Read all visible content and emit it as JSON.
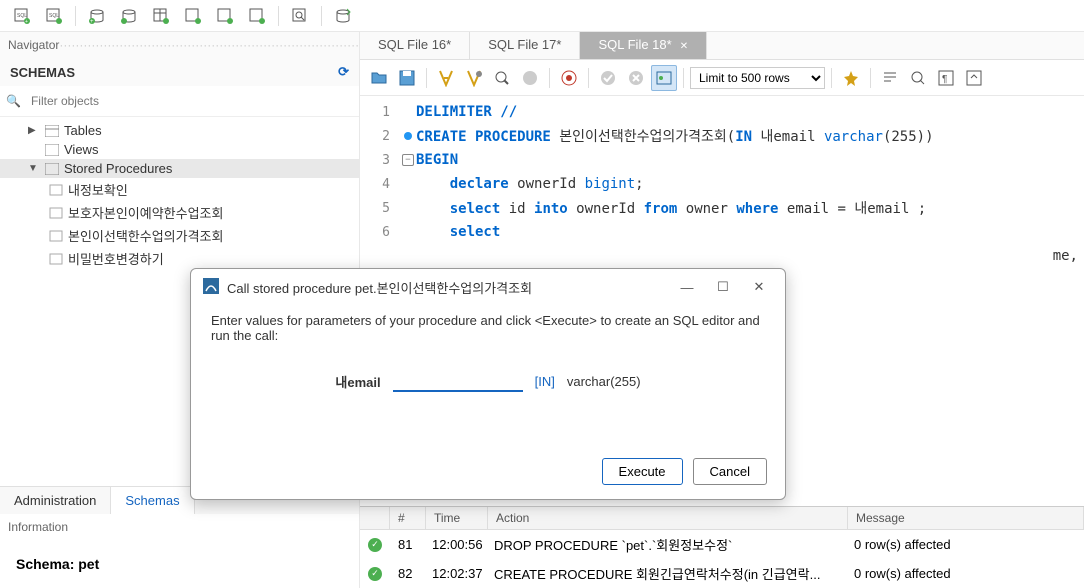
{
  "navigator": {
    "title": "Navigator"
  },
  "schemas": {
    "header": "SCHEMAS",
    "filter_placeholder": "Filter objects",
    "tree": {
      "tables": "Tables",
      "views": "Views",
      "stored_procs": "Stored Procedures",
      "sp_items": [
        "내정보확인",
        "보호자본인이예약한수업조회",
        "본인이선택한수업의가격조회",
        "비밀번호변경하기"
      ]
    }
  },
  "lower_tabs": {
    "admin": "Administration",
    "schemas": "Schemas"
  },
  "info": {
    "header": "Information",
    "schema_label": "Schema: ",
    "schema_value": "pet"
  },
  "file_tabs": [
    {
      "label": "SQL File 16*"
    },
    {
      "label": "SQL File 17*"
    },
    {
      "label": "SQL File 18*",
      "active": true
    }
  ],
  "editor_tb": {
    "limit": "Limit to 500 rows"
  },
  "code": {
    "l1": "DELIMITER //",
    "l2_a": "CREATE PROCEDURE ",
    "l2_b": "본인이선택한수업의가격조회",
    "l2_c": "(",
    "l2_d": "IN",
    "l2_e": " 내email ",
    "l2_f": "varchar",
    "l2_g": "(255))",
    "l3": "BEGIN",
    "l4_a": "    declare ",
    "l4_b": "ownerId ",
    "l4_c": "bigint",
    "l4_d": ";",
    "l5_a": "    select ",
    "l5_b": "id ",
    "l5_c": "into ",
    "l5_d": "ownerId ",
    "l5_e": "from ",
    "l5_f": "owner ",
    "l5_g": "where ",
    "l5_h": "email = 내email ;",
    "l6": "    select",
    "trail": "me,"
  },
  "output": {
    "cols": {
      "num": "#",
      "time": "Time",
      "action": "Action",
      "msg": "Message"
    },
    "rows": [
      {
        "num": "81",
        "time": "12:00:56",
        "action": "DROP PROCEDURE `pet`.`회원정보수정`",
        "msg": "0 row(s) affected"
      },
      {
        "num": "82",
        "time": "12:02:37",
        "action": "CREATE PROCEDURE 회원긴급연락처수정(in 긴급연락...",
        "msg": "0 row(s) affected"
      }
    ]
  },
  "dialog": {
    "title": "Call stored procedure pet.본인이선택한수업의가격조회",
    "instruction": "Enter values for parameters of your procedure and click <Execute> to create an SQL editor and run the call:",
    "param_label": "내email",
    "param_dir": "[IN]",
    "param_type": "varchar(255)",
    "execute": "Execute",
    "cancel": "Cancel"
  }
}
